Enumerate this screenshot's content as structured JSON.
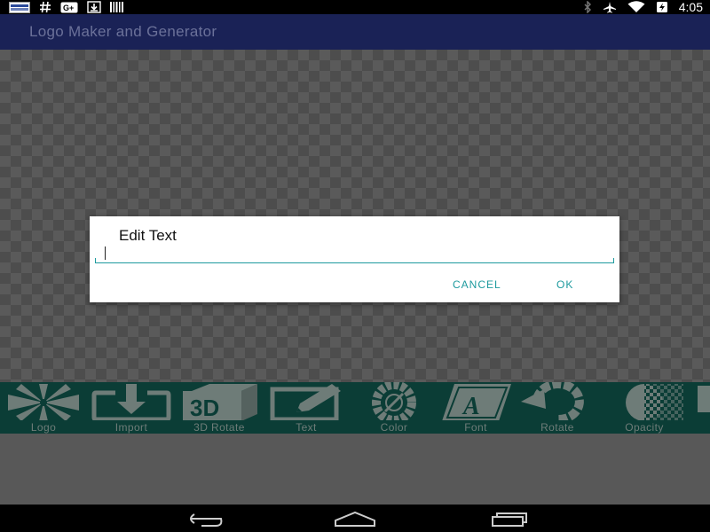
{
  "status_bar": {
    "time": "4:05",
    "left_icons": [
      "notification-badge-icon",
      "hashtag-icon",
      "google-plus-icon",
      "download-icon",
      "barcode-icon"
    ],
    "right_icons": [
      "bluetooth-icon",
      "airplane-mode-icon",
      "wifi-icon",
      "battery-charging-icon"
    ]
  },
  "app_bar": {
    "title": "Logo Maker and Generator"
  },
  "toolbar": {
    "items": [
      {
        "label": "Logo",
        "icon": "logo-starburst-icon"
      },
      {
        "label": "Import",
        "icon": "import-icon"
      },
      {
        "label": "3D Rotate",
        "icon": "3d-cube-icon"
      },
      {
        "label": "Text",
        "icon": "edit-text-icon"
      },
      {
        "label": "Color",
        "icon": "color-wheel-icon"
      },
      {
        "label": "Font",
        "icon": "font-icon"
      },
      {
        "label": "Rotate",
        "icon": "rotate-icon"
      },
      {
        "label": "Opacity",
        "icon": "opacity-icon"
      }
    ]
  },
  "dialog": {
    "title": "Edit Text",
    "input_value": "",
    "cancel_label": "CANCEL",
    "ok_label": "OK"
  },
  "nav_bar": {
    "icons": [
      "back-icon",
      "home-icon",
      "recents-icon"
    ]
  },
  "colors": {
    "app_bar": "#1a2256",
    "toolbar": "#0b3d36",
    "accent": "#1e9a9e"
  }
}
